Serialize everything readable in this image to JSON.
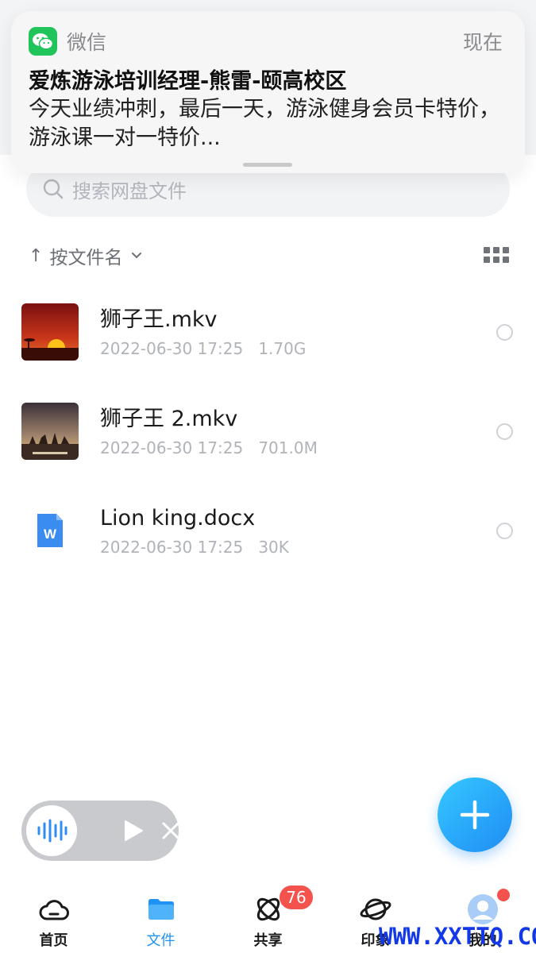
{
  "notification": {
    "app": "微信",
    "time": "现在",
    "title": "爱炼游泳培训经理-熊雷-颐高校区",
    "body": "今天业绩冲刺，最后一天，游泳健身会员卡特价，游泳课一对一特价..."
  },
  "search": {
    "placeholder": "搜索网盘文件"
  },
  "sort": {
    "label": "按文件名",
    "arrow": "↑"
  },
  "files": [
    {
      "name": "狮子王.mkv",
      "date": "2022-06-30 17:25",
      "size": "1.70G",
      "thumb": "sunset-thumbnail"
    },
    {
      "name": "狮子王 2.mkv",
      "date": "2022-06-30 17:25",
      "size": "701.0M",
      "thumb": "savanna-thumbnail"
    },
    {
      "name": "Lion king.docx",
      "date": "2022-06-30 17:25",
      "size": "30K",
      "thumb": "word-doc-icon"
    }
  ],
  "tabs": [
    {
      "label": "首页",
      "icon": "cloud-icon"
    },
    {
      "label": "文件",
      "icon": "folder-icon"
    },
    {
      "label": "共享",
      "icon": "atom-icon"
    },
    {
      "label": "印象",
      "icon": "planet-icon"
    },
    {
      "label": "我的",
      "icon": "avatar-icon"
    }
  ],
  "share_badge": "76",
  "watermark": "WWW.XXTTQ.COM",
  "colors": {
    "accent": "#1e93f4",
    "badge": "#f4524d",
    "wechat": "#21c45a"
  }
}
